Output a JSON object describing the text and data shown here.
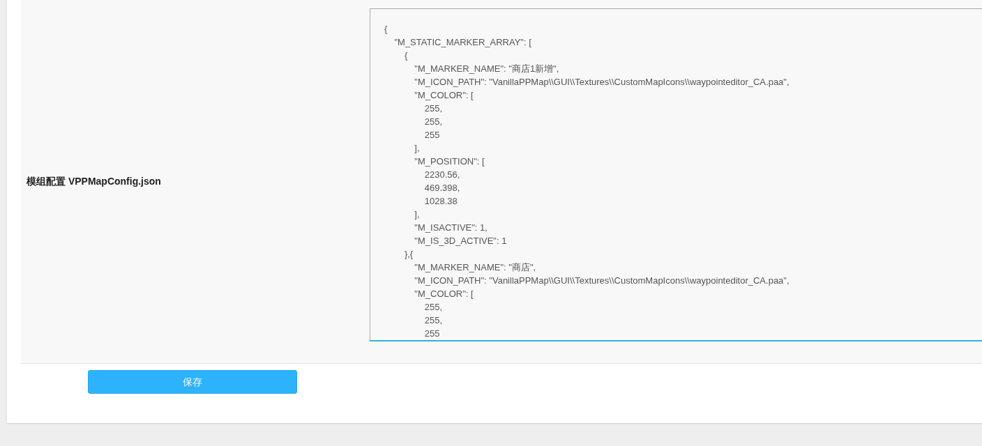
{
  "form": {
    "field_label": "模组配置 VPPMapConfig.json",
    "editor": {
      "focused": true,
      "value": "{\n    \"M_STATIC_MARKER_ARRAY\": [\n        {\n            \"M_MARKER_NAME\": \"商店1新增\",\n            \"M_ICON_PATH\": \"VanillaPPMap\\\\GUI\\\\Textures\\\\CustomMapIcons\\\\waypointeditor_CA.paa\",\n            \"M_COLOR\": [\n                255,\n                255,\n                255\n            ],\n            \"M_POSITION\": [\n                2230.56,\n                469.398,\n                1028.38\n            ],\n            \"M_ISACTIVE\": 1,\n            \"M_IS_3D_ACTIVE\": 1\n        },{\n            \"M_MARKER_NAME\": \"商店\",\n            \"M_ICON_PATH\": \"VanillaPPMap\\\\GUI\\\\Textures\\\\CustomMapIcons\\\\waypointeditor_CA.paa\",\n            \"M_COLOR\": [\n                255,\n                255,\n                255"
    },
    "save_button": "保存"
  }
}
